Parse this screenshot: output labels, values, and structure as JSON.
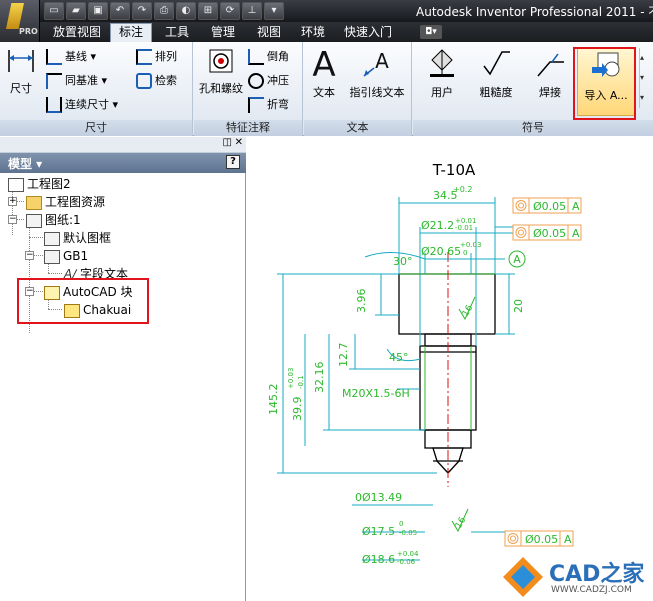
{
  "window": {
    "title": "Autodesk Inventor Professional 2011 - 不",
    "app_badge": "PRO"
  },
  "qat": [
    "new-icon",
    "open-icon",
    "save-icon",
    "undo-icon",
    "redo-icon",
    "print-icon",
    "appearance-icon",
    "select-icon",
    "update-icon",
    "measure-icon",
    "dropdown-icon"
  ],
  "tabs": [
    {
      "label": "放置视图",
      "active": false
    },
    {
      "label": "标注",
      "active": true
    },
    {
      "label": "工具",
      "active": false
    },
    {
      "label": "管理",
      "active": false
    },
    {
      "label": "视图",
      "active": false
    },
    {
      "label": "环境",
      "active": false
    },
    {
      "label": "快速入门",
      "active": false
    }
  ],
  "ribbon": {
    "dimension": {
      "title": "尺寸",
      "big_label": "尺寸",
      "baseline": "基线",
      "ordinate": "同基准",
      "chain": "连续尺寸",
      "arrange": "排列",
      "retrieve": "检索"
    },
    "feature_notes": {
      "title": "特征注释",
      "hole_thread": "孔和螺纹",
      "chamfer": "倒角",
      "punch": "冲压",
      "bend": "折弯"
    },
    "text": {
      "title": "文本",
      "text": "文本",
      "leader": "指引线文本"
    },
    "symbols": {
      "title": "符号",
      "user": "用户",
      "roughness": "粗糙度",
      "weld": "焊接",
      "import": "导入 A..."
    }
  },
  "browser": {
    "title": "模型 ▾",
    "help": "?",
    "nodes": {
      "drawing": "工程图2",
      "resources": "工程图资源",
      "sheet": "图纸:1",
      "border": "默认图框",
      "titleblock": "GB1",
      "field_text": "字段文本",
      "autocad_block": "AutoCAD 块",
      "block_item": "Chakuai"
    }
  },
  "drawing": {
    "title": "T-10A",
    "dims": {
      "d1": "34.5",
      "d1_tol": "+0.2",
      "d2": "Ø21.2",
      "d2_tol_up": "+0.01",
      "d2_tol_dn": "-0.01",
      "d3": "Ø20.65",
      "d3_tol_up": "+0.03",
      "d3_tol_dn": "0",
      "angle30": "30°",
      "h396": "3.96",
      "h20": "20",
      "h127": "12.7",
      "h3216": "32.16",
      "angle45": "45°",
      "thread": "M20X1.5-6H",
      "h1452": "145.2",
      "h399": "39.9",
      "h399_tol_up": "+0.03",
      "h399_tol_dn": "-0.1",
      "d1349": "0Ø13.49",
      "d175": "Ø17.5",
      "d175_tol_up": "0",
      "d175_tol_dn": "-0.05",
      "d186": "Ø18.6",
      "d186_tol_up": "+0.04",
      "d186_tol_dn": "-0.06",
      "rough1": "16",
      "rough2": "16"
    },
    "fcf": [
      {
        "tol": "Ø0.05",
        "datum": "A"
      },
      {
        "tol": "Ø0.05",
        "datum": "A"
      },
      {
        "tol": "Ø0.05",
        "datum": "A"
      }
    ],
    "datum_label": "A"
  },
  "watermark": {
    "brand": "CAD之家",
    "url": "WWW.CADZJ.COM"
  }
}
